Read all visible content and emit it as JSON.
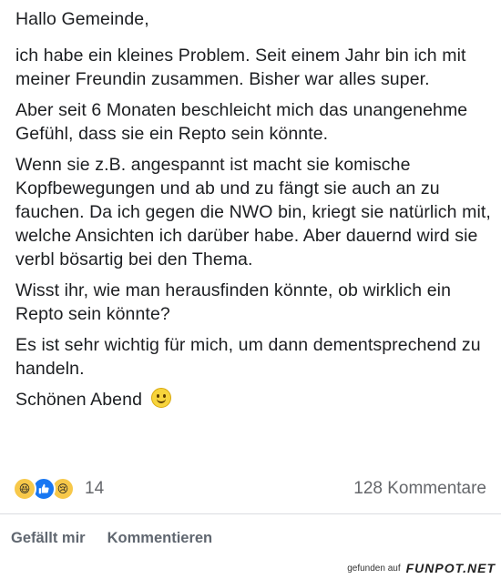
{
  "post": {
    "paragraphs": [
      "Hallo Gemeinde,",
      "ich habe ein kleines Problem. Seit einem Jahr bin ich mit meiner Freundin zusammen. Bisher war alles super.",
      "Aber seit 6 Monaten beschleicht mich das unangenehme Gefühl, dass sie ein Repto sein könnte.",
      "Wenn sie z.B. angespannt ist macht sie komische Kopfbewegungen und ab und zu fängt sie auch an zu fauchen. Da ich gegen die NWO bin, kriegt sie natürlich mit, welche Ansichten ich darüber habe. Aber dauernd wird sie verbl bösartig bei den Thema.",
      "Wisst ihr, wie man herausfinden könnte, ob wirklich ein Repto sein könnte?",
      "Es ist sehr wichtig für mich, um dann dementsprechend zu handeln."
    ],
    "closing": "Schönen Abend",
    "closing_emoji": "smiley-icon"
  },
  "stats": {
    "reaction_icons": [
      "haha-icon",
      "like-icon",
      "sad-icon"
    ],
    "reaction_count": "14",
    "comments": "128 Kommentare"
  },
  "actions": {
    "like": "Gefällt mir",
    "comment": "Kommentieren"
  },
  "watermark": {
    "prefix": "gefunden auf",
    "brand": "FUNPOT.NET"
  },
  "colors": {
    "like_blue": "#1877f2",
    "emoji_yellow": "#f7c84a",
    "muted_text": "#65676b"
  }
}
